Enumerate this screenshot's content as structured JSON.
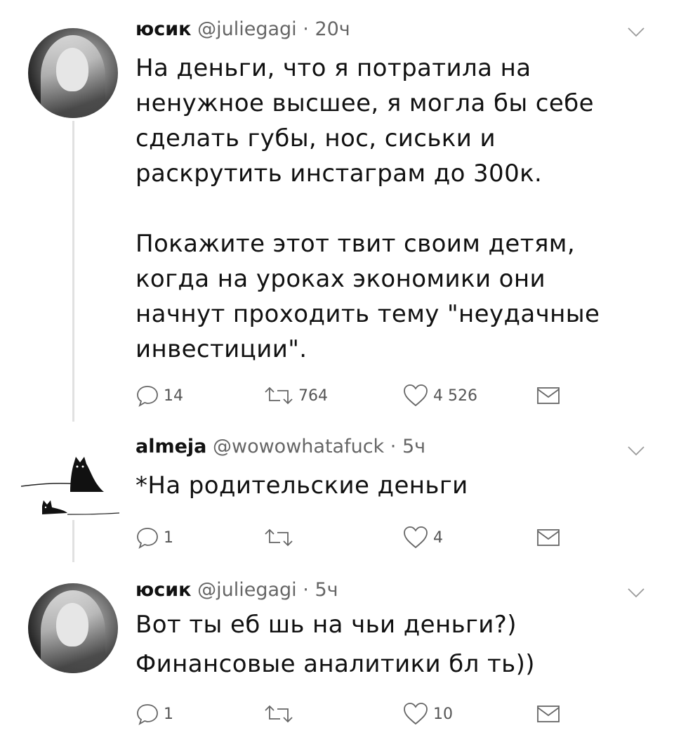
{
  "tweets": [
    {
      "name": "юсик",
      "handle": "@juliegagi",
      "separator": "·",
      "time": "20ч",
      "paragraphs": [
        "На деньги, что я потратила на ненужное высшее, я могла бы себе сделать губы, нос, сиськи и раскрутить инстаграм до 300к.",
        "Покажите этот твит своим детям, когда на уроках экономики они начнут проходить тему \"неудачные инвестиции\"."
      ],
      "replies": "14",
      "retweets": "764",
      "likes": "4 526"
    },
    {
      "name": "almeja",
      "handle": "@wowowhatafuck",
      "separator": "·",
      "time": "5ч",
      "paragraphs": [
        "*На родительские деньги"
      ],
      "replies": "1",
      "retweets": "",
      "likes": "4"
    },
    {
      "name": "юсик",
      "handle": "@juliegagi",
      "separator": "·",
      "time": "5ч",
      "paragraphs": [
        "Вот ты еб  шь на чьи деньги?)",
        "Финансовые аналитики бл  ть))"
      ],
      "replies": "1",
      "retweets": "",
      "likes": "10"
    }
  ],
  "icons": {
    "reply": "reply-icon",
    "retweet": "retweet-icon",
    "like": "heart-icon",
    "dm": "envelope-icon",
    "more": "chevron-down-icon"
  }
}
